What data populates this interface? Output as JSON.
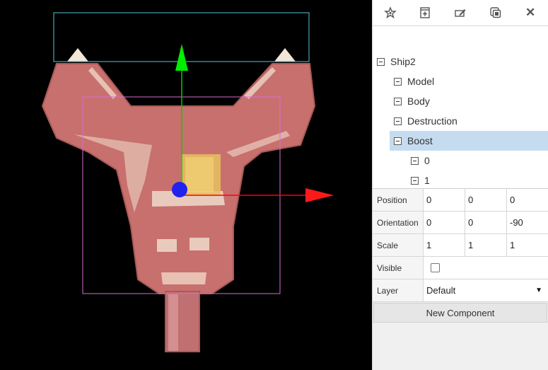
{
  "toolbar": {
    "icons": [
      "star-icon",
      "add-child-icon",
      "edit-icon",
      "duplicate-icon",
      "delete-icon"
    ],
    "delete_glyph": "✕"
  },
  "tree": {
    "root": "Ship2",
    "children": [
      "Model",
      "Body",
      "Destruction",
      "Boost"
    ],
    "boost_children": [
      "0",
      "1"
    ],
    "selected": "Boost"
  },
  "properties": {
    "position": {
      "label": "Position",
      "x": "0",
      "y": "0",
      "z": "0"
    },
    "orientation": {
      "label": "Orientation",
      "x": "0",
      "y": "0",
      "z": "-90"
    },
    "scale": {
      "label": "Scale",
      "x": "1",
      "y": "1",
      "z": "1"
    },
    "visible": {
      "label": "Visible",
      "checked": false
    },
    "layer": {
      "label": "Layer",
      "value": "Default",
      "arrow": "▼"
    }
  },
  "new_component_label": "New Component",
  "colors": {
    "selection": "#c5dcf0",
    "gizmo_x": "#ff0000",
    "gizmo_y": "#00cc00",
    "gizmo_center": "#2222ee",
    "bbox_top": "#59c6d4",
    "bbox_main": "#d76bd1",
    "ship": "#c8706e"
  }
}
